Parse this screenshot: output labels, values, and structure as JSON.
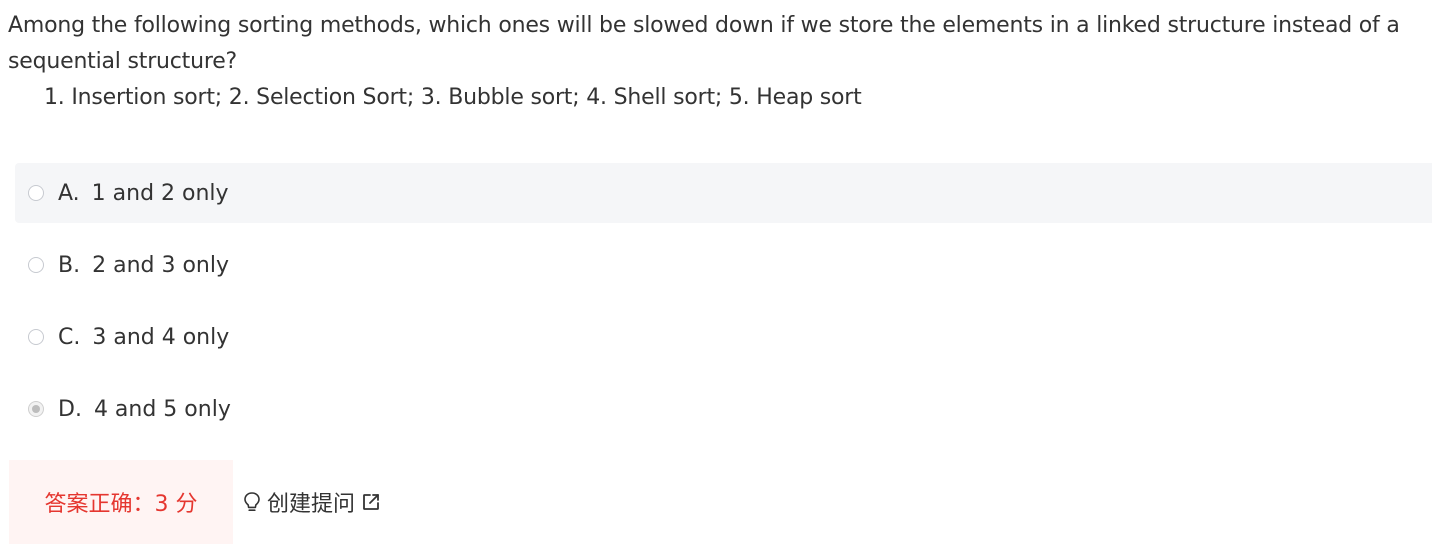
{
  "question": {
    "stem": "Among the following sorting methods, which ones will be slowed down if we store the elements in a linked structure instead of a sequential structure?",
    "list": "1. Insertion sort; 2. Selection Sort; 3. Bubble sort; 4. Shell sort; 5. Heap sort"
  },
  "options": [
    {
      "letter": "A.",
      "text": "1 and 2 only",
      "selected": false
    },
    {
      "letter": "B.",
      "text": "2 and 3 only",
      "selected": false
    },
    {
      "letter": "C.",
      "text": "3 and 4 only",
      "selected": false
    },
    {
      "letter": "D.",
      "text": "4 and 5 only",
      "selected": true
    }
  ],
  "result": {
    "text": "答案正确：3 分"
  },
  "ask": {
    "label": "创建提问",
    "bulb_icon": "lightbulb-icon",
    "external_icon": "external-link-icon"
  },
  "colors": {
    "result_text": "#e5362f",
    "result_bg": "#fff4f3",
    "hover_bg": "#f5f6f8"
  }
}
